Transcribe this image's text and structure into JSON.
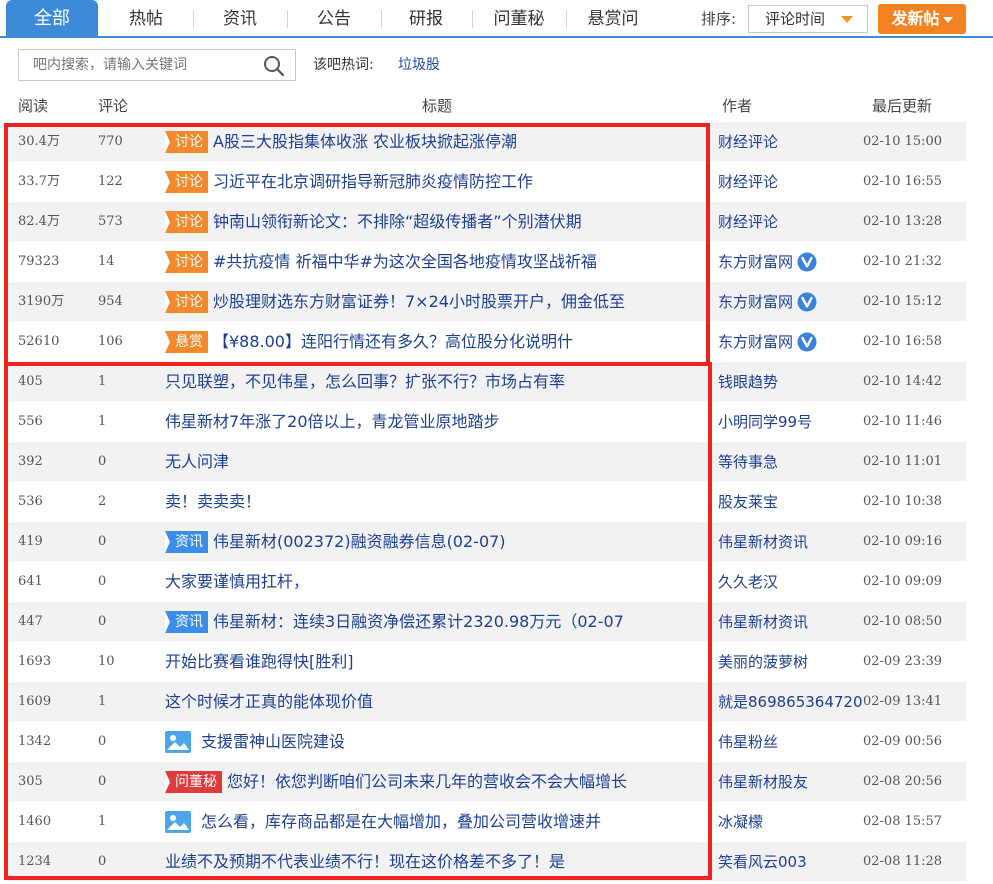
{
  "tabs": {
    "active": "全部",
    "items": [
      "热帖",
      "资讯",
      "公告",
      "研报",
      "问董秘",
      "悬赏问"
    ]
  },
  "sort": {
    "label": "排序:",
    "value": "评论时间"
  },
  "post_button": "发新帖",
  "search": {
    "placeholder": "吧内搜索，请输入关键词"
  },
  "hot": {
    "label": "该吧热词:",
    "word": "垃圾股"
  },
  "columns": {
    "read": "阅读",
    "comment": "评论",
    "title": "标题",
    "author": "作者",
    "time": "最后更新"
  },
  "colors": {
    "accent": "#3c8ad8",
    "orange": "#f08a2c",
    "link": "#1c3f94",
    "highlight": "#ee2222"
  },
  "rows": [
    {
      "read": "30.4万",
      "comment": "770",
      "tag": "讨论",
      "tag_color": "orange",
      "title": "A股三大股指集体收涨 农业板块掀起涨停潮",
      "author": "财经评论",
      "verified": false,
      "time": "02-10 15:00"
    },
    {
      "read": "33.7万",
      "comment": "122",
      "tag": "讨论",
      "tag_color": "orange",
      "title": "习近平在北京调研指导新冠肺炎疫情防控工作",
      "author": "财经评论",
      "verified": false,
      "time": "02-10 16:55"
    },
    {
      "read": "82.4万",
      "comment": "573",
      "tag": "讨论",
      "tag_color": "orange",
      "title": "钟南山领衔新论文：不排除“超级传播者”个别潜伏期",
      "author": "财经评论",
      "verified": false,
      "time": "02-10 13:28"
    },
    {
      "read": "79323",
      "comment": "14",
      "tag": "讨论",
      "tag_color": "orange",
      "title": "#共抗疫情 祈福中华#为这次全国各地疫情攻坚战祈福",
      "author": "东方财富网",
      "verified": true,
      "time": "02-10 21:32"
    },
    {
      "read": "3190万",
      "comment": "954",
      "tag": "讨论",
      "tag_color": "orange",
      "title": "炒股理财选东方财富证券！7×24小时股票开户，佣金低至",
      "author": "东方财富网",
      "verified": true,
      "time": "02-10 15:12"
    },
    {
      "read": "52610",
      "comment": "106",
      "tag": "悬赏",
      "tag_color": "orange",
      "title": "【¥88.00】连阳行情还有多久？高位股分化说明什",
      "author": "东方财富网",
      "verified": true,
      "time": "02-10 16:58"
    },
    {
      "read": "405",
      "comment": "1",
      "tag": "",
      "tag_color": "",
      "title": "只见联塑，不见伟星，怎么回事？扩张不行？市场占有率",
      "author": "钱眼趋势",
      "verified": false,
      "time": "02-10 14:42"
    },
    {
      "read": "556",
      "comment": "1",
      "tag": "",
      "tag_color": "",
      "title": "伟星新材7年涨了20倍以上，青龙管业原地踏步",
      "author": "小明同学99号",
      "verified": false,
      "time": "02-10 11:46"
    },
    {
      "read": "392",
      "comment": "0",
      "tag": "",
      "tag_color": "",
      "title": "无人问津",
      "author": "等待事急",
      "verified": false,
      "time": "02-10 11:01"
    },
    {
      "read": "536",
      "comment": "2",
      "tag": "",
      "tag_color": "",
      "title": "卖！卖卖卖！",
      "author": "股友莱宝",
      "verified": false,
      "time": "02-10 10:38"
    },
    {
      "read": "419",
      "comment": "0",
      "tag": "资讯",
      "tag_color": "blue",
      "title": "伟星新材(002372)融资融券信息(02-07)",
      "author": "伟星新材资讯",
      "verified": false,
      "time": "02-10 09:16"
    },
    {
      "read": "641",
      "comment": "0",
      "tag": "",
      "tag_color": "",
      "title": "大家要谨慎用扛杆，",
      "author": "久久老汉",
      "verified": false,
      "time": "02-10 09:09"
    },
    {
      "read": "447",
      "comment": "0",
      "tag": "资讯",
      "tag_color": "blue",
      "title": "伟星新材：连续3日融资净偿还累计2320.98万元（02-07",
      "author": "伟星新材资讯",
      "verified": false,
      "time": "02-10 08:50"
    },
    {
      "read": "1693",
      "comment": "10",
      "tag": "",
      "tag_color": "",
      "title": "开始比赛看谁跑得快[胜利]",
      "author": "美丽的菠萝树",
      "verified": false,
      "time": "02-09 23:39"
    },
    {
      "read": "1609",
      "comment": "1",
      "tag": "",
      "tag_color": "",
      "title": "这个时候才正真的能体现价值",
      "author": "就是869865364720",
      "verified": false,
      "time": "02-09 13:41"
    },
    {
      "read": "1342",
      "comment": "0",
      "tag": "",
      "tag_color": "",
      "image": true,
      "title": "支援雷神山医院建设",
      "author": "伟星粉丝",
      "verified": false,
      "time": "02-09 00:56"
    },
    {
      "read": "305",
      "comment": "0",
      "tag": "问董秘",
      "tag_color": "red",
      "title": "您好！依您判断咱们公司未来几年的营收会不会大幅增长",
      "author": "伟星新材股友",
      "verified": false,
      "time": "02-08 20:56"
    },
    {
      "read": "1460",
      "comment": "1",
      "tag": "",
      "tag_color": "",
      "image": true,
      "title": "怎么看，库存商品都是在大幅增加，叠加公司营收增速并",
      "author": "冰凝檬",
      "verified": false,
      "time": "02-08 15:57"
    },
    {
      "read": "1234",
      "comment": "0",
      "tag": "",
      "tag_color": "",
      "title": "业绩不及预期不代表业绩不行！现在这价格差不多了！是",
      "author": "笑看风云003",
      "verified": false,
      "time": "02-08 11:28"
    }
  ]
}
